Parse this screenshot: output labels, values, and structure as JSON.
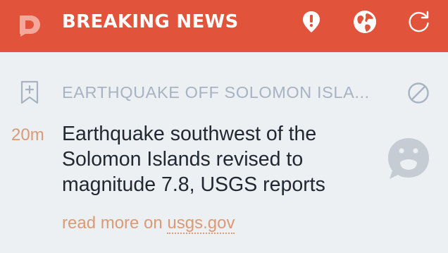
{
  "header": {
    "title": "BREAKING NEWS",
    "logo_icon": "breaking-news-logo-icon",
    "actions": [
      {
        "name": "alert-pin-icon"
      },
      {
        "name": "globe-icon"
      },
      {
        "name": "refresh-icon"
      }
    ]
  },
  "story": {
    "topic": "EARTHQUAKE OFF SOLOMON ISLA...",
    "time_ago": "20m",
    "headline_lines": [
      "Earthquake southwest of the",
      "Solomon Islands revised to",
      "magnitude 7.8, USGS reports"
    ],
    "read_more_prefix": "read more on",
    "source": "usgs.gov"
  },
  "colors": {
    "header_bg": "#e1533a",
    "background": "#edf0f3",
    "accent_text": "#d99a76",
    "muted_text": "#a7b3c2"
  }
}
